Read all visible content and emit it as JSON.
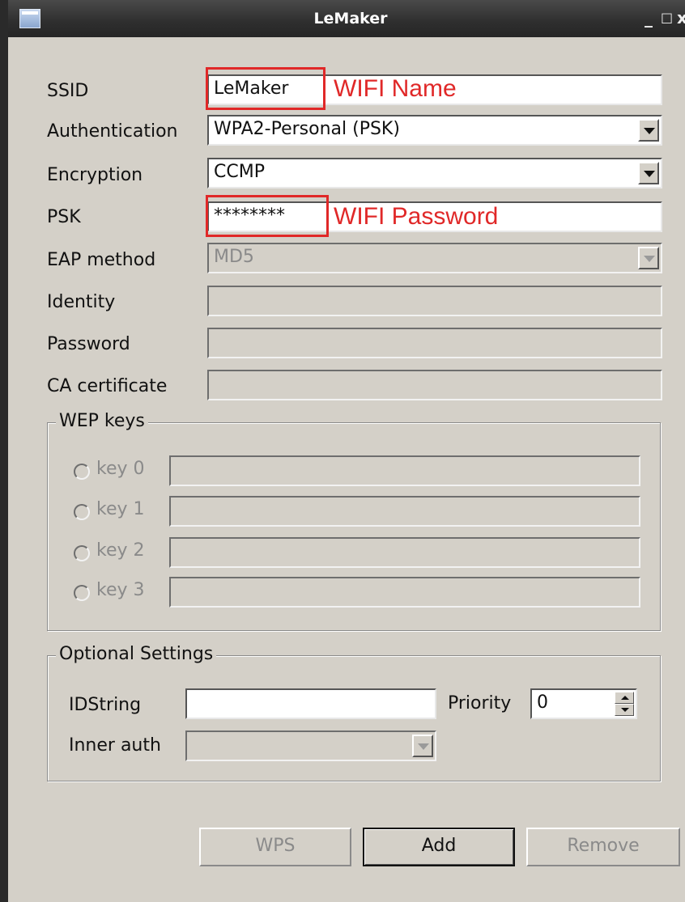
{
  "window": {
    "title": "LeMaker",
    "controls": {
      "minimize": "_",
      "maximize": "□",
      "close": "x"
    }
  },
  "form": {
    "ssid": {
      "label": "SSID",
      "value": "LeMaker",
      "annotation": "WIFI Name"
    },
    "authentication": {
      "label": "Authentication",
      "value": "WPA2-Personal (PSK)"
    },
    "encryption": {
      "label": "Encryption",
      "value": "CCMP"
    },
    "psk": {
      "label": "PSK",
      "value": "********",
      "annotation": "WIFI Password"
    },
    "eap_method": {
      "label": "EAP method",
      "value": "MD5"
    },
    "identity": {
      "label": "Identity",
      "value": ""
    },
    "password": {
      "label": "Password",
      "value": ""
    },
    "ca_certificate": {
      "label": "CA certificate",
      "value": ""
    }
  },
  "wep": {
    "title": "WEP keys",
    "keys": [
      {
        "label": "key 0",
        "value": ""
      },
      {
        "label": "key 1",
        "value": ""
      },
      {
        "label": "key 2",
        "value": ""
      },
      {
        "label": "key 3",
        "value": ""
      }
    ]
  },
  "optional": {
    "title": "Optional Settings",
    "idstring": {
      "label": "IDString",
      "value": ""
    },
    "priority": {
      "label": "Priority",
      "value": "0"
    },
    "inner_auth": {
      "label": "Inner auth",
      "value": ""
    }
  },
  "buttons": {
    "wps": "WPS",
    "add": "Add",
    "remove": "Remove"
  },
  "colors": {
    "annotation": "#e02828",
    "window_bg": "#d4d0c8",
    "titlebar": "#2e2e2e"
  }
}
